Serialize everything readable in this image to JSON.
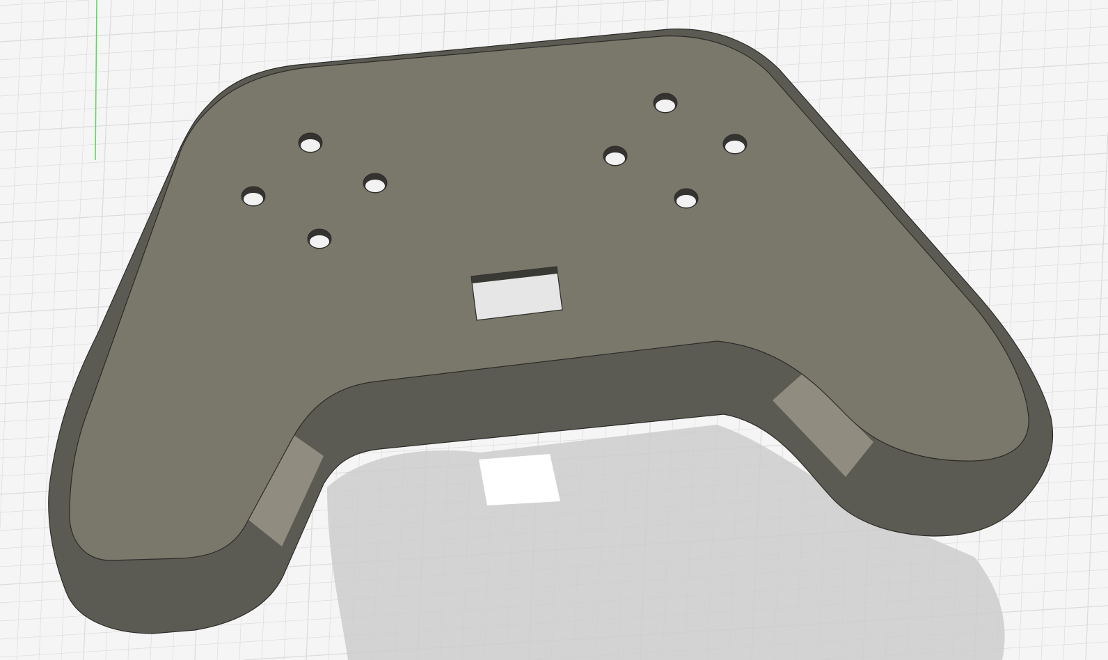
{
  "viewport": {
    "background_color": "#f5f5f5",
    "grid_color": "#dcdcdc",
    "axis_color": "#5cd65c"
  },
  "model": {
    "name_icon": "controller-plate-model",
    "top_face_color": "#7a776b",
    "side_color": "#5c5b53",
    "edge_color": "#2b2b28",
    "hole_count": 9,
    "shadow_color": "#cbcbcb"
  }
}
